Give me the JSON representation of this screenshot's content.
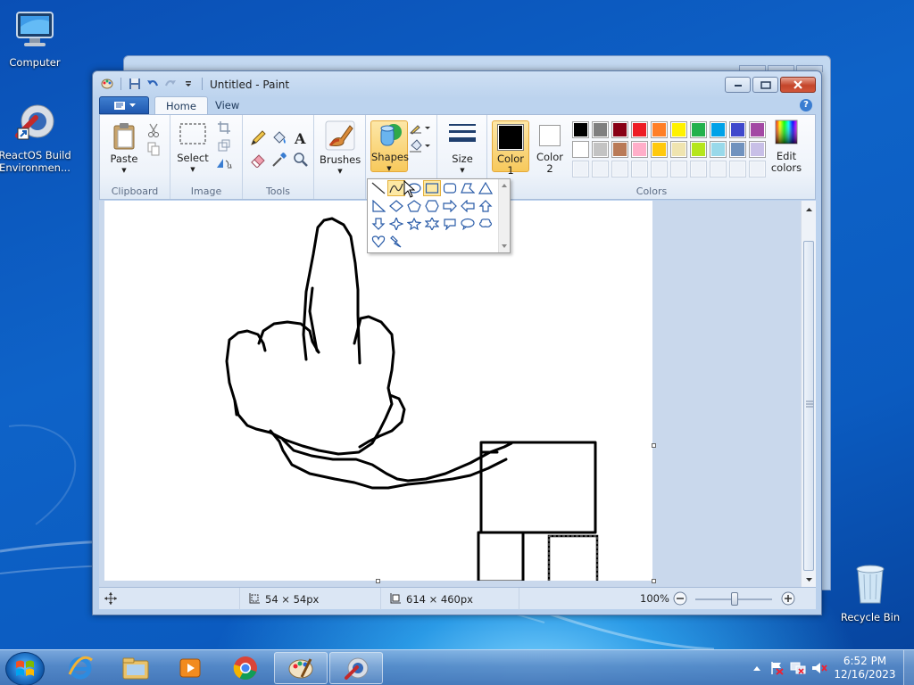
{
  "desktop": {
    "icons": [
      {
        "label": "Computer"
      },
      {
        "label": "ReactOS Build Environmen..."
      },
      {
        "label": "Recycle Bin"
      }
    ]
  },
  "window": {
    "title": "Untitled - Paint",
    "tabs": [
      "Home",
      "View"
    ],
    "help": "?"
  },
  "ribbon": {
    "clipboard": {
      "label": "Clipboard",
      "paste": "Paste"
    },
    "image": {
      "label": "Image",
      "select": "Select"
    },
    "tools": {
      "label": "Tools"
    },
    "brushes": {
      "label": "Brushes"
    },
    "shapes": {
      "label": "Shapes"
    },
    "size": {
      "label": "Size"
    },
    "colors": {
      "label": "Colors",
      "color1": "Color\n1",
      "color1_line1": "Color",
      "color1_line2": "1",
      "color2_line1": "Color",
      "color2_line2": "2",
      "edit_line1": "Edit",
      "edit_line2": "colors",
      "color1_value": "#000000",
      "color2_value": "#ffffff",
      "palette_row1": [
        "#000000",
        "#7f7f7f",
        "#880015",
        "#ed1c24",
        "#ff7f27",
        "#fff200",
        "#22b14c",
        "#00a2e8",
        "#3f48cc",
        "#a349a4"
      ],
      "palette_row2": [
        "#ffffff",
        "#c3c3c3",
        "#b97a57",
        "#ffaec9",
        "#ffc90e",
        "#efe4b0",
        "#b5e61d",
        "#99d9ea",
        "#7092be",
        "#c8bfe7"
      ]
    }
  },
  "status": {
    "selection_size": "54 × 54px",
    "image_size": "614 × 460px",
    "zoom": "100%"
  },
  "taskbar": {
    "time": "6:52 PM",
    "date": "12/16/2023"
  }
}
